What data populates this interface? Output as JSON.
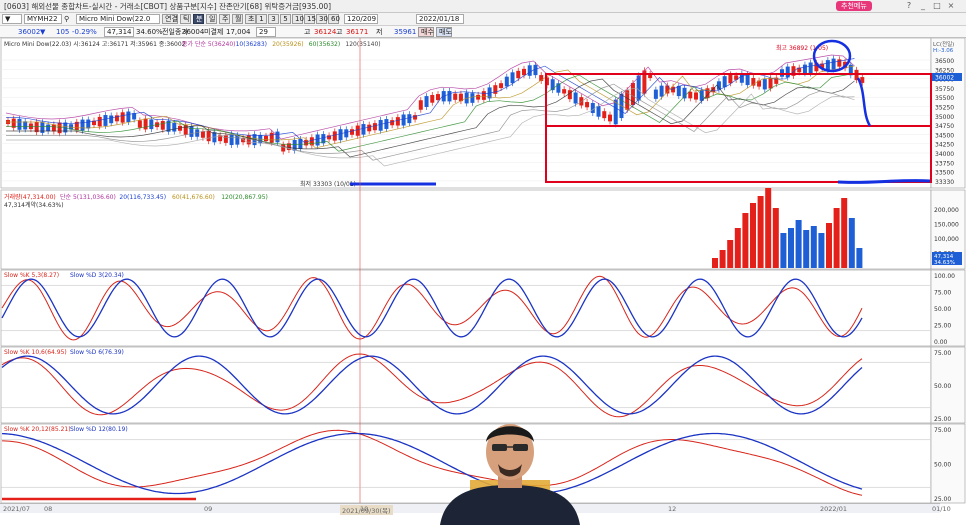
{
  "window": {
    "title": "[0603] 해외선물 종합차트-실시간 - 거래소[CBOT] 상품구분[지수] 잔존만기[68] 위탁증거금[935.00]",
    "promo_label": "추천메뉴",
    "controls": [
      "?",
      "_",
      "□",
      "×"
    ]
  },
  "toolbar": {
    "symbol_code": "MYMH22",
    "symbol_name": "Micro Mini Dow(22.0",
    "period_buttons": [
      "연결",
      "틱",
      "분",
      "일",
      "주",
      "월",
      "초"
    ],
    "num_buttons": [
      "1",
      "3",
      "5",
      "10",
      "15",
      "30",
      "60"
    ],
    "count_value": "120/209",
    "date_value": "2022/01/18",
    "price_label": "36002",
    "price_arrow": "▼",
    "change": "105",
    "change_pct": "-0.29%",
    "volume": "47,314",
    "volume_ratio": "34.60%",
    "prev_close_label": "전일종가",
    "prev_close": "36004",
    "unsettled_label": "미결제",
    "unsettled": "17,004",
    "unsettled_change": "29",
    "high_label": "고",
    "high": "36124",
    "high2": "36171",
    "low_label": "저",
    "low": "35961",
    "buy_label": "매수",
    "sell_label": "매도"
  },
  "colors": {
    "up": "#e3211a",
    "down": "#1f5fd6",
    "stoch_k": "#d7261c",
    "stoch_d": "#1b34c4",
    "highlight_box": "#e0001b",
    "annotation_blue": "#1430e0",
    "fill_over": "#f3b3a3",
    "fill_under": "#9fc6e8"
  },
  "price_panel": {
    "legend": [
      "Micro Mini Dow(22.03) 시:36124 고:36171 저:35961 종:36002",
      "종가 단순 5(36240)",
      "10(36283)",
      "20(35926)",
      "60(35632)",
      "120(35140)"
    ],
    "high_annotation": "최고 36892 (1/05)",
    "low_annotation": "최저 33303 (10/01)",
    "current_price": "36002",
    "ylabels": [
      "36500",
      "36250",
      "36000",
      "35750",
      "35500",
      "35250",
      "35000",
      "34750",
      "34500",
      "34250",
      "34000",
      "33750",
      "33500",
      "33330"
    ],
    "right_top_labels": [
      "LC(전일)",
      "H:-3.06",
      "36002",
      "-0.29%"
    ]
  },
  "volume_panel": {
    "legend": [
      "거래량(47,314.00)",
      "단순 5(131,036.60)",
      "20(116,733.45)",
      "60(41,676.60)",
      "120(20,867.95)"
    ],
    "sublegend": "47,314계약(34.63%)",
    "ylabels": [
      "200,000",
      "150,000",
      "100,000",
      "50,000"
    ],
    "current": "47,314",
    "current_pct": "34.63%"
  },
  "stoch_panels": [
    {
      "legend_k": "Slow %K 5,3(8.27)",
      "legend_d": "Slow %D 3(20.34)",
      "ylabels": [
        "100.00",
        "75.00",
        "50.00",
        "25.00",
        "0.00"
      ]
    },
    {
      "legend_k": "Slow %K 10,6(64.95)",
      "legend_d": "Slow %D 6(76.39)",
      "ylabels": [
        "75.00",
        "50.00",
        "25.00"
      ]
    },
    {
      "legend_k": "Slow %K 20,12(85.21)",
      "legend_d": "Slow %D 12(80.19)",
      "ylabels": [
        "75.00",
        "50.00",
        "25.00"
      ]
    }
  ],
  "x_axis": {
    "labels": [
      "2021/07",
      "08",
      "09",
      "10",
      "11",
      "12",
      "2022/01",
      "01/10"
    ],
    "crosshair_label": "2021/09/30(목)"
  }
}
